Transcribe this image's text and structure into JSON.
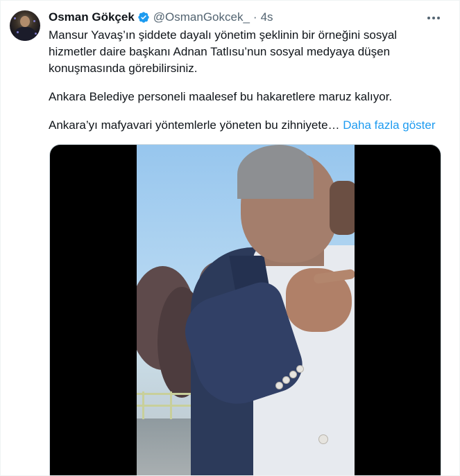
{
  "tweet": {
    "author_name": "Osman Gökçek",
    "author_handle": "@OsmanGokcek_",
    "separator": "·",
    "time": "4s",
    "text": {
      "line1": "Mansur Yavaş’ın şiddete dayalı yönetim şeklinin bir örneğini sosyal hizmetler daire başkanı Adnan Tatlısu’nun sosyal medyaya düşen konuşmasında görebilirsiniz.",
      "line2": "Ankara Belediye personeli maalesef bu hakaretlere maruz kalıyor.",
      "line3": "Ankara’yı mafyavari yöntemlerle yöneten bu zihniyete…",
      "show_more": "Daha fazla göster"
    },
    "colors": {
      "accent": "#1d9bf0",
      "secondary_text": "#536471",
      "primary_text": "#0f1419"
    },
    "icons": {
      "verified": "verified-badge-icon",
      "more": "more-dots-icon"
    }
  }
}
